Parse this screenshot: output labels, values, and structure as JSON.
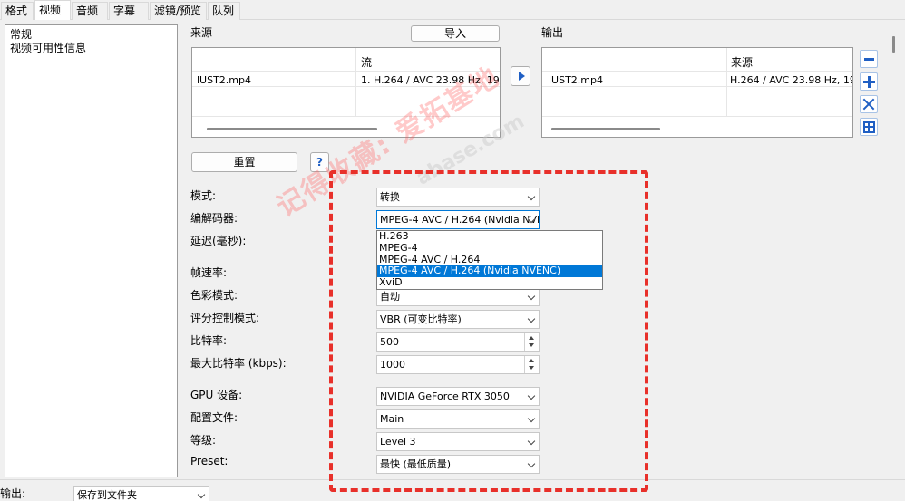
{
  "tabs": [
    "格式",
    "视频",
    "音频",
    "字幕",
    "滤镜/预览",
    "队列"
  ],
  "active_tab": 1,
  "left_panel": {
    "items": [
      "常规",
      "视频可用性信息"
    ]
  },
  "source": {
    "label": "来源",
    "import_label": "导入",
    "col_stream": "流",
    "row": {
      "file": "lUST2.mp4",
      "stream": "1. H.264 / AVC  23.98 Hz, 1920"
    }
  },
  "output": {
    "label": "输出",
    "col_source": "来源",
    "row": {
      "file": "lUST2.mp4",
      "source": "H.264 / AVC  23.98 Hz, 192"
    }
  },
  "reset_label": "重置",
  "help_label": "?",
  "form": {
    "mode_label": "模式:",
    "mode_value": "转换",
    "codec_label": "编解码器:",
    "codec_value": "MPEG-4 AVC / H.264 (Nvidia NVE",
    "delay_label": "延迟(毫秒):",
    "fps_label": "帧速率:",
    "color_label": "色彩模式:",
    "color_value": "自动",
    "rate_control_label": "评分控制模式:",
    "rate_control_value": "VBR (可变比特率)",
    "bitrate_label": "比特率:",
    "bitrate_value": "500",
    "max_bitrate_label": "最大比特率 (kbps):",
    "max_bitrate_value": "1000",
    "gpu_label": "GPU 设备:",
    "gpu_value": "NVIDIA GeForce RTX 3050",
    "profile_label": "配置文件:",
    "profile_value": "Main",
    "level_label": "等级:",
    "level_value": "Level 3",
    "preset_label": "Preset:",
    "preset_value": "最快 (最低质量)"
  },
  "codec_options": [
    "H.263",
    "MPEG-4",
    "MPEG-4 AVC / H.264",
    "MPEG-4 AVC / H.264 (Nvidia NVENC)",
    "XviD"
  ],
  "codec_selected_index": 3,
  "bottom": {
    "label": "输出:",
    "value": "保存到文件夹"
  },
  "watermark": "记得收藏: 爱拓基地",
  "watermark_url": "abase.com",
  "colors": {
    "accent": "#0078d7",
    "annotation": "#e8302a",
    "tool_icon": "#1f5fc4"
  }
}
